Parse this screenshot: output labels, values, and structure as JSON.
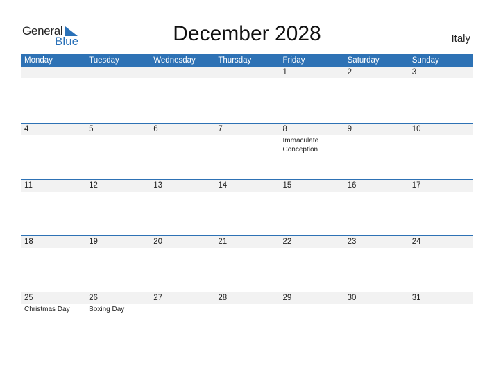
{
  "logo": {
    "word1": "General",
    "word2": "Blue",
    "icon": "triangle-flag-icon",
    "accent": "#2a71b8"
  },
  "title": "December 2028",
  "country": "Italy",
  "header_color": "#2e72b5",
  "weekdays": [
    "Monday",
    "Tuesday",
    "Wednesday",
    "Thursday",
    "Friday",
    "Saturday",
    "Sunday"
  ],
  "weeks": [
    {
      "days": [
        "",
        "",
        "",
        "",
        "1",
        "2",
        "3"
      ],
      "holidays": [
        "",
        "",
        "",
        "",
        "",
        "",
        ""
      ]
    },
    {
      "days": [
        "4",
        "5",
        "6",
        "7",
        "8",
        "9",
        "10"
      ],
      "holidays": [
        "",
        "",
        "",
        "",
        "Immaculate Conception",
        "",
        ""
      ]
    },
    {
      "days": [
        "11",
        "12",
        "13",
        "14",
        "15",
        "16",
        "17"
      ],
      "holidays": [
        "",
        "",
        "",
        "",
        "",
        "",
        ""
      ]
    },
    {
      "days": [
        "18",
        "19",
        "20",
        "21",
        "22",
        "23",
        "24"
      ],
      "holidays": [
        "",
        "",
        "",
        "",
        "",
        "",
        ""
      ]
    },
    {
      "days": [
        "25",
        "26",
        "27",
        "28",
        "29",
        "30",
        "31"
      ],
      "holidays": [
        "Christmas Day",
        "Boxing Day",
        "",
        "",
        "",
        "",
        ""
      ]
    }
  ]
}
